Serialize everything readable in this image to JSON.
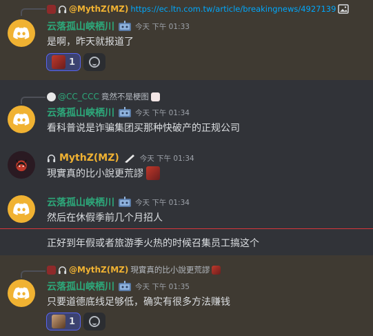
{
  "messages": [
    {
      "reply": {
        "author": "@MythZ(MZ)",
        "text": "https://ec.ltn.com.tw/article/breakingnews/4927139"
      },
      "author": "云落孤山峡栖川",
      "timestamp": "今天 下午 01:33",
      "content": "是啊，昨天就报道了",
      "reaction_count": "1"
    },
    {
      "reply": {
        "author": "@CC_CCC",
        "text": "竟然不是梗图"
      },
      "author": "云落孤山峡栖川",
      "timestamp": "今天 下午 01:34",
      "content": "看科普说是诈骗集团买那种快破产的正规公司"
    },
    {
      "author": "MythZ(MZ)",
      "timestamp": "今天 下午 01:34",
      "content": "現實真的比小說更荒謬"
    },
    {
      "author": "云落孤山峡栖川",
      "timestamp": "今天 下午 01:34",
      "content": "然后在休假季前几个月招人",
      "content2": "正好到年假或者旅游季火热的时候召集员工搞这个"
    },
    {
      "reply": {
        "author": "@MythZ(MZ)",
        "text": "現實真的比小說更荒謬"
      },
      "author": "云落孤山峡栖川",
      "timestamp": "今天 下午 01:35",
      "content": "只要道德底线足够低，确实有很多方法赚钱",
      "reaction_count": "1"
    }
  ],
  "colors": {
    "accent_name": "#2da87a",
    "gold_name": "#f0b232",
    "link": "#00a8fc",
    "new_divider": "#da373c"
  },
  "icons": [
    "discord-logo-icon",
    "headphones-icon",
    "image-icon",
    "bot-badge-icon",
    "add-reaction-icon"
  ]
}
